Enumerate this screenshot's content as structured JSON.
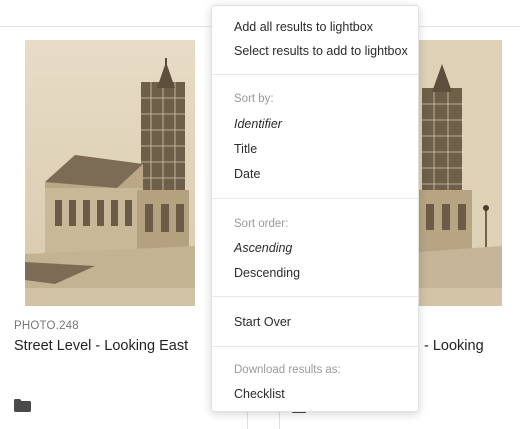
{
  "results": [
    {
      "identifier": "PHOTO.248",
      "title": "Street Level - Looking East"
    },
    {
      "identifier": "",
      "title": "- Looking"
    }
  ],
  "menu": {
    "lightbox": {
      "add_all": "Add all results to lightbox",
      "select": "Select results to add to lightbox"
    },
    "sort_by": {
      "heading": "Sort by:",
      "options": [
        "Identifier",
        "Title",
        "Date"
      ],
      "selected": "Identifier"
    },
    "sort_order": {
      "heading": "Sort order:",
      "options": [
        "Ascending",
        "Descending"
      ],
      "selected": "Ascending"
    },
    "start_over": "Start Over",
    "download": {
      "heading": "Download results as:",
      "options": [
        "Checklist"
      ]
    }
  },
  "icons": {
    "folder": "folder-icon"
  },
  "colors": {
    "photo_sepia_light": "#d9c8ab",
    "photo_sepia_dark": "#6a5a45",
    "menu_border": "#e2e2e2",
    "heading_gray": "#9a9a9a"
  }
}
